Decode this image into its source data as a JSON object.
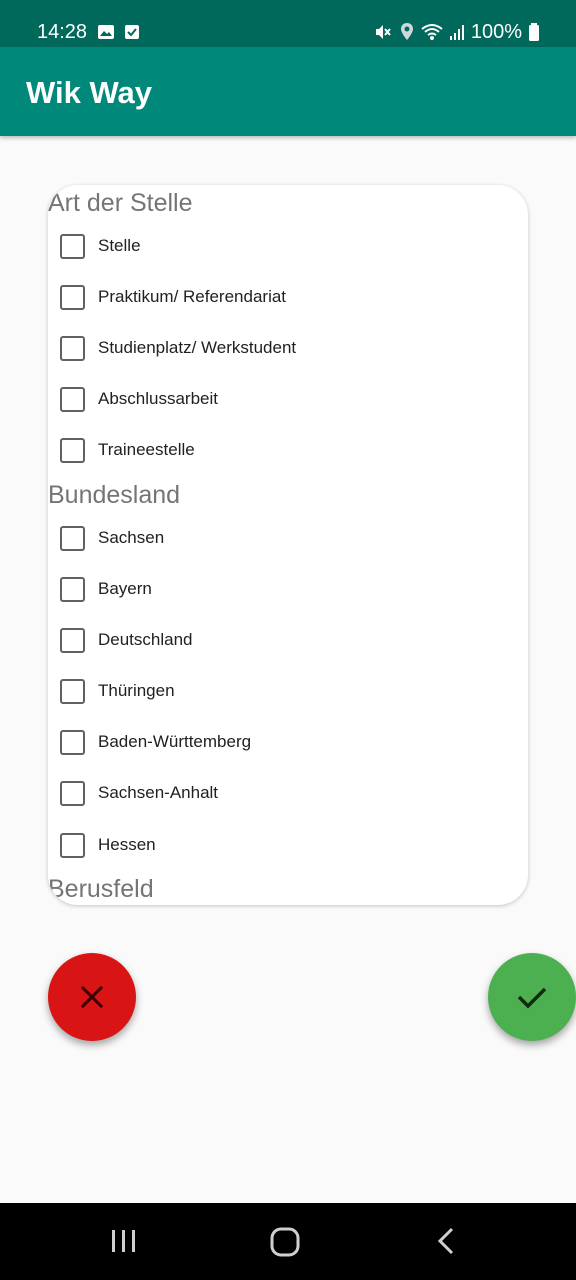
{
  "status_bar": {
    "time": "14:28",
    "battery": "100%",
    "left_icons": [
      "image-icon",
      "check-box-icon"
    ],
    "right_icons": [
      "mute-icon",
      "location-icon",
      "wifi-icon",
      "signal-icon",
      "battery-icon"
    ]
  },
  "app_bar": {
    "title": "Wik Way"
  },
  "filters": {
    "art_title": "Art der Stelle",
    "art_items": [
      {
        "label": "Stelle",
        "checked": false
      },
      {
        "label": "Praktikum/ Referendariat",
        "checked": false
      },
      {
        "label": "Studienplatz/ Werkstudent",
        "checked": false
      },
      {
        "label": "Abschlussarbeit",
        "checked": false
      },
      {
        "label": "Traineestelle",
        "checked": false
      }
    ],
    "bundesland_title": "Bundesland",
    "bundesland_items": [
      {
        "label": "Sachsen",
        "checked": false
      },
      {
        "label": "Bayern",
        "checked": false
      },
      {
        "label": "Deutschland",
        "checked": false
      },
      {
        "label": "Thüringen",
        "checked": false
      },
      {
        "label": "Baden-Württemberg",
        "checked": false
      },
      {
        "label": "Sachsen-Anhalt",
        "checked": false
      },
      {
        "label": "Hessen",
        "checked": false
      }
    ],
    "berufsfeld_title": "Berusfeld"
  },
  "actions": {
    "cancel_icon": "close-icon",
    "confirm_icon": "check-icon",
    "cancel_color": "#d81414",
    "confirm_color": "#4caf50"
  },
  "nav_bar": {
    "icons": [
      "recents-icon",
      "home-icon",
      "back-icon"
    ]
  }
}
